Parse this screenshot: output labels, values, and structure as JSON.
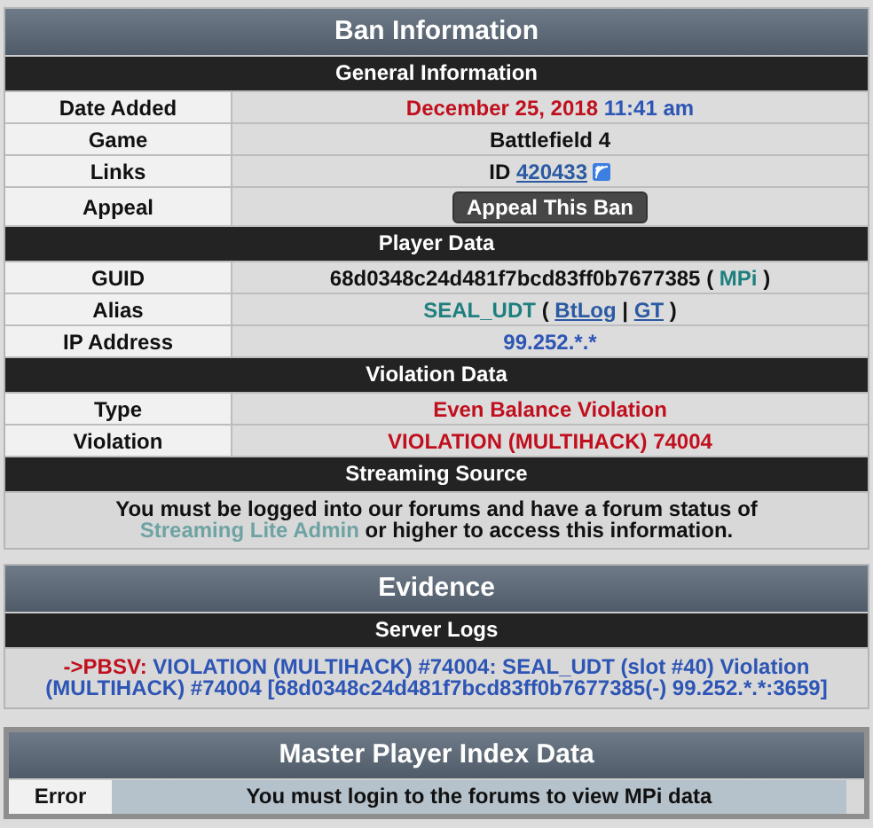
{
  "panels": [
    {
      "title": "Ban Information",
      "kind": "table",
      "sections": [
        {
          "heading": "General Information",
          "rows": [
            {
              "label": "Date Added",
              "kind": "text",
              "parts": [
                {
                  "text": "December 25, 2018",
                  "kind": "alert"
                },
                {
                  "text": "11:41 am",
                  "kind": "info"
                }
              ]
            },
            {
              "label": "Game",
              "kind": "text",
              "parts": [
                {
                  "text": "Battlefield 4",
                  "kind": "plain"
                }
              ]
            },
            {
              "label": "Links",
              "kind": "text",
              "feed_icon": true,
              "parts": [
                {
                  "text": "ID",
                  "kind": "plain"
                },
                {
                  "text": "420433",
                  "kind": "link"
                }
              ]
            },
            {
              "label": "Appeal",
              "kind": "button",
              "button": "Appeal This Ban"
            }
          ]
        },
        {
          "heading": "Player Data",
          "rows": [
            {
              "label": "GUID",
              "kind": "text",
              "parts": [
                {
                  "text": "68d0348c24d481f7bcd83ff0b7677385",
                  "kind": "plain"
                },
                {
                  "text": "(",
                  "kind": "plain"
                },
                {
                  "text": "MPi",
                  "kind": "teal-link"
                },
                {
                  "text": ")",
                  "kind": "plain"
                }
              ]
            },
            {
              "label": "Alias",
              "kind": "text",
              "parts": [
                {
                  "text": "SEAL_UDT",
                  "kind": "teal-link"
                },
                {
                  "text": "(",
                  "kind": "plain"
                },
                {
                  "text": "BtLog",
                  "kind": "link"
                },
                {
                  "text": "|",
                  "kind": "plain"
                },
                {
                  "text": "GT",
                  "kind": "link"
                },
                {
                  "text": ")",
                  "kind": "plain"
                }
              ]
            },
            {
              "label": "IP Address",
              "kind": "text",
              "parts": [
                {
                  "text": "99.252.*.*",
                  "kind": "info"
                }
              ]
            }
          ]
        },
        {
          "heading": "Violation Data",
          "rows": [
            {
              "label": "Type",
              "kind": "text",
              "parts": [
                {
                  "text": "Even Balance Violation",
                  "kind": "alert"
                }
              ]
            },
            {
              "label": "Violation",
              "kind": "text",
              "parts": [
                {
                  "text": "VIOLATION (MULTIHACK) 74004",
                  "kind": "alert"
                }
              ]
            }
          ]
        },
        {
          "heading": "Streaming Source",
          "message": [
            {
              "text": "You must be logged into our forums and have a forum status of",
              "kind": "plain"
            },
            {
              "text": "Streaming Lite Admin",
              "kind": "muted-link"
            },
            {
              "text": "or higher to access this information.",
              "kind": "plain"
            }
          ]
        }
      ]
    },
    {
      "title": "Evidence",
      "kind": "log",
      "sections": [
        {
          "heading": "Server Logs",
          "log": {
            "prefix": "->PBSV:",
            "text": "VIOLATION (MULTIHACK) #74004: SEAL_UDT (slot #40) Violation (MULTIHACK) #74004 [68d0348c24d481f7bcd83ff0b7677385(-) 99.252.*.*:3659]"
          }
        }
      ]
    },
    {
      "title": "Master Player Index Data",
      "kind": "error",
      "error": {
        "label": "Error",
        "message": "You must login to the forums to view MPi data"
      }
    }
  ]
}
